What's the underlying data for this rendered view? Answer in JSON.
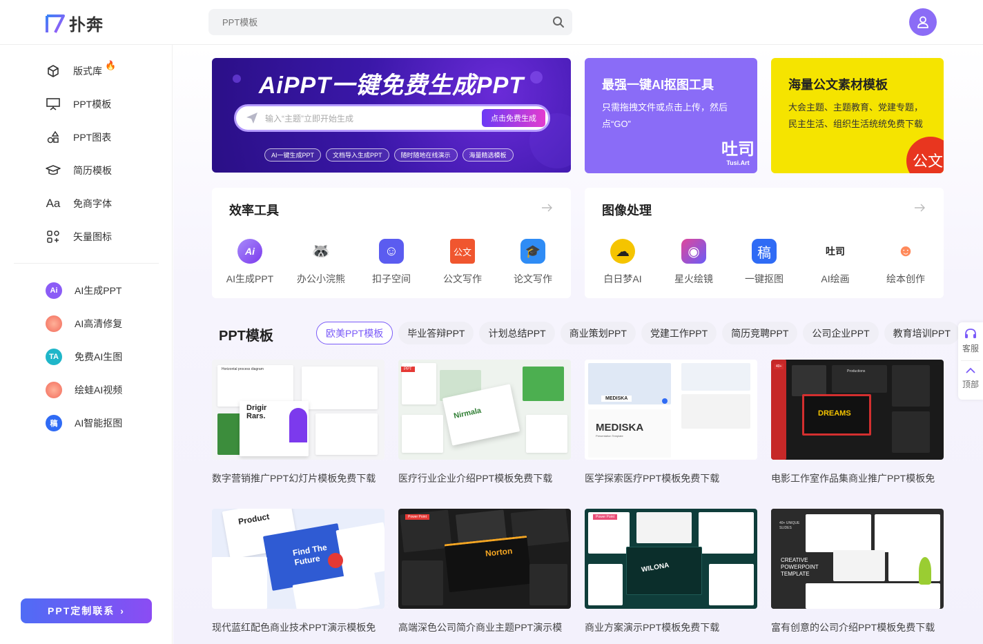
{
  "header": {
    "logo_text": "扑奔",
    "search_placeholder": "PPT模板"
  },
  "sidebar": {
    "items": [
      {
        "label": "版式库",
        "icon": "cube-icon"
      },
      {
        "label": "PPT模板",
        "icon": "presentation-icon"
      },
      {
        "label": "PPT图表",
        "icon": "shapes-icon"
      },
      {
        "label": "简历模板",
        "icon": "graduation-cap-icon"
      },
      {
        "label": "免商字体",
        "icon": "font-icon"
      },
      {
        "label": "矢量图标",
        "icon": "vector-grid-icon"
      }
    ],
    "ai_items": [
      {
        "label": "AI生成PPT",
        "icon": "ai-ppt-icon",
        "badge": "Ai",
        "color": "#8b5cf6"
      },
      {
        "label": "AI高清修复",
        "icon": "ai-restore-icon",
        "badge": "",
        "color": "#f26b5b"
      },
      {
        "label": "免费AI生图",
        "icon": "ai-image-icon",
        "badge": "TA",
        "color": "#1fb6c9"
      },
      {
        "label": "绘蛙AI视频",
        "icon": "ai-video-icon",
        "badge": "",
        "color": "#f26b5b"
      },
      {
        "label": "AI智能抠图",
        "icon": "ai-cutout-icon",
        "badge": "稿",
        "color": "#2f6bf5"
      }
    ],
    "contact_label": "PPT定制联系"
  },
  "banners": {
    "ai": {
      "title": "AiPPT一键免费生成PPT",
      "input_placeholder": "输入“主题”立即开始生成",
      "button": "点击免费生成",
      "tags": [
        "AI一键生成PPT",
        "文档导入生成PPT",
        "随时随地在线演示",
        "海量精选模板"
      ]
    },
    "cutout": {
      "title": "最强一键AI抠图工具",
      "desc": "只需拖拽文件或点击上传，然后点“GO”",
      "logo": "Tusi.Art"
    },
    "docs": {
      "title": "海量公文素材模板",
      "desc": "大会主题、主题教育、党建专题，民主生活、组织生活统统免费下载",
      "badge": "公文"
    }
  },
  "tools": {
    "efficiency": {
      "title": "效率工具",
      "items": [
        {
          "label": "AI生成PPT",
          "color": "#8b5cf6",
          "glyph": "Ai"
        },
        {
          "label": "办公小浣熊",
          "color": "#333333",
          "glyph": "🦝"
        },
        {
          "label": "扣子空间",
          "color": "#5b5cf0",
          "glyph": "☺"
        },
        {
          "label": "公文写作",
          "color": "#f0562f",
          "glyph": "公文"
        },
        {
          "label": "论文写作",
          "color": "#2f8cf5",
          "glyph": "🎓"
        }
      ]
    },
    "image": {
      "title": "图像处理",
      "items": [
        {
          "label": "白日梦AI",
          "color": "#f5c400",
          "glyph": "☁"
        },
        {
          "label": "星火绘镜",
          "color": "#e0469a",
          "glyph": "◉"
        },
        {
          "label": "一键抠图",
          "color": "#2f6bf5",
          "glyph": "稿"
        },
        {
          "label": "AI绘画",
          "color": "#222222",
          "glyph": "吐司"
        },
        {
          "label": "绘本创作",
          "color": "#ff8a5b",
          "glyph": "☻"
        }
      ]
    }
  },
  "ppt_section": {
    "title": "PPT模板",
    "tabs": [
      "欧美PPT模板",
      "毕业答辩PPT",
      "计划总结PPT",
      "商业策划PPT",
      "党建工作PPT",
      "简历竞聘PPT",
      "公司企业PPT",
      "教育培训PPT"
    ],
    "active_tab": 0,
    "templates": [
      {
        "caption": "数字营销推广PPT幻灯片模板免费下载",
        "thumb_text": "Drigir Rars.",
        "thumb_sub": "Horizontal process diagram",
        "bg": "#f4f4f6",
        "accent": "#7c3aed"
      },
      {
        "caption": "医疗行业企业介绍PPT模板免费下载",
        "thumb_text": "Nirmala",
        "thumb_sub": "PPT",
        "bg": "#eef3ee",
        "accent": "#4caf50"
      },
      {
        "caption": "医学探索医疗PPT模板免费下载",
        "thumb_text": "MEDISKA",
        "thumb_sub": "Presentation Template",
        "bg": "#ffffff",
        "accent": "#2f6bf5"
      },
      {
        "caption": "电影工作室作品集商业推广PPT模板免",
        "thumb_text": "DREAMS",
        "thumb_sub": "Productions",
        "bg": "#1a1a1a",
        "accent": "#d32f2f"
      },
      {
        "caption": "现代蓝红配色商业技术PPT演示模板免",
        "thumb_text": "Find The Future",
        "thumb_sub": "Product",
        "bg": "#e9eefb",
        "accent": "#2f5bd3"
      },
      {
        "caption": "高端深色公司简介商业主题PPT演示模",
        "thumb_text": "Norton",
        "thumb_sub": "Power Point",
        "bg": "#1c1c1c",
        "accent": "#f5a623"
      },
      {
        "caption": "商业方案演示PPT模板免费下载",
        "thumb_text": "WILONA",
        "thumb_sub": "Power Point",
        "bg": "#0f3d3a",
        "accent": "#e94e77"
      },
      {
        "caption": "富有创意的公司介绍PPT模板免费下载",
        "thumb_text": "CREATIVE POWERPOINT TEMPLATE",
        "thumb_sub": "40+ UNIQUE SLIDES",
        "bg": "#2b2b2b",
        "accent": "#9acd32"
      }
    ]
  },
  "float_bar": {
    "service": "客服",
    "top": "顶部"
  }
}
